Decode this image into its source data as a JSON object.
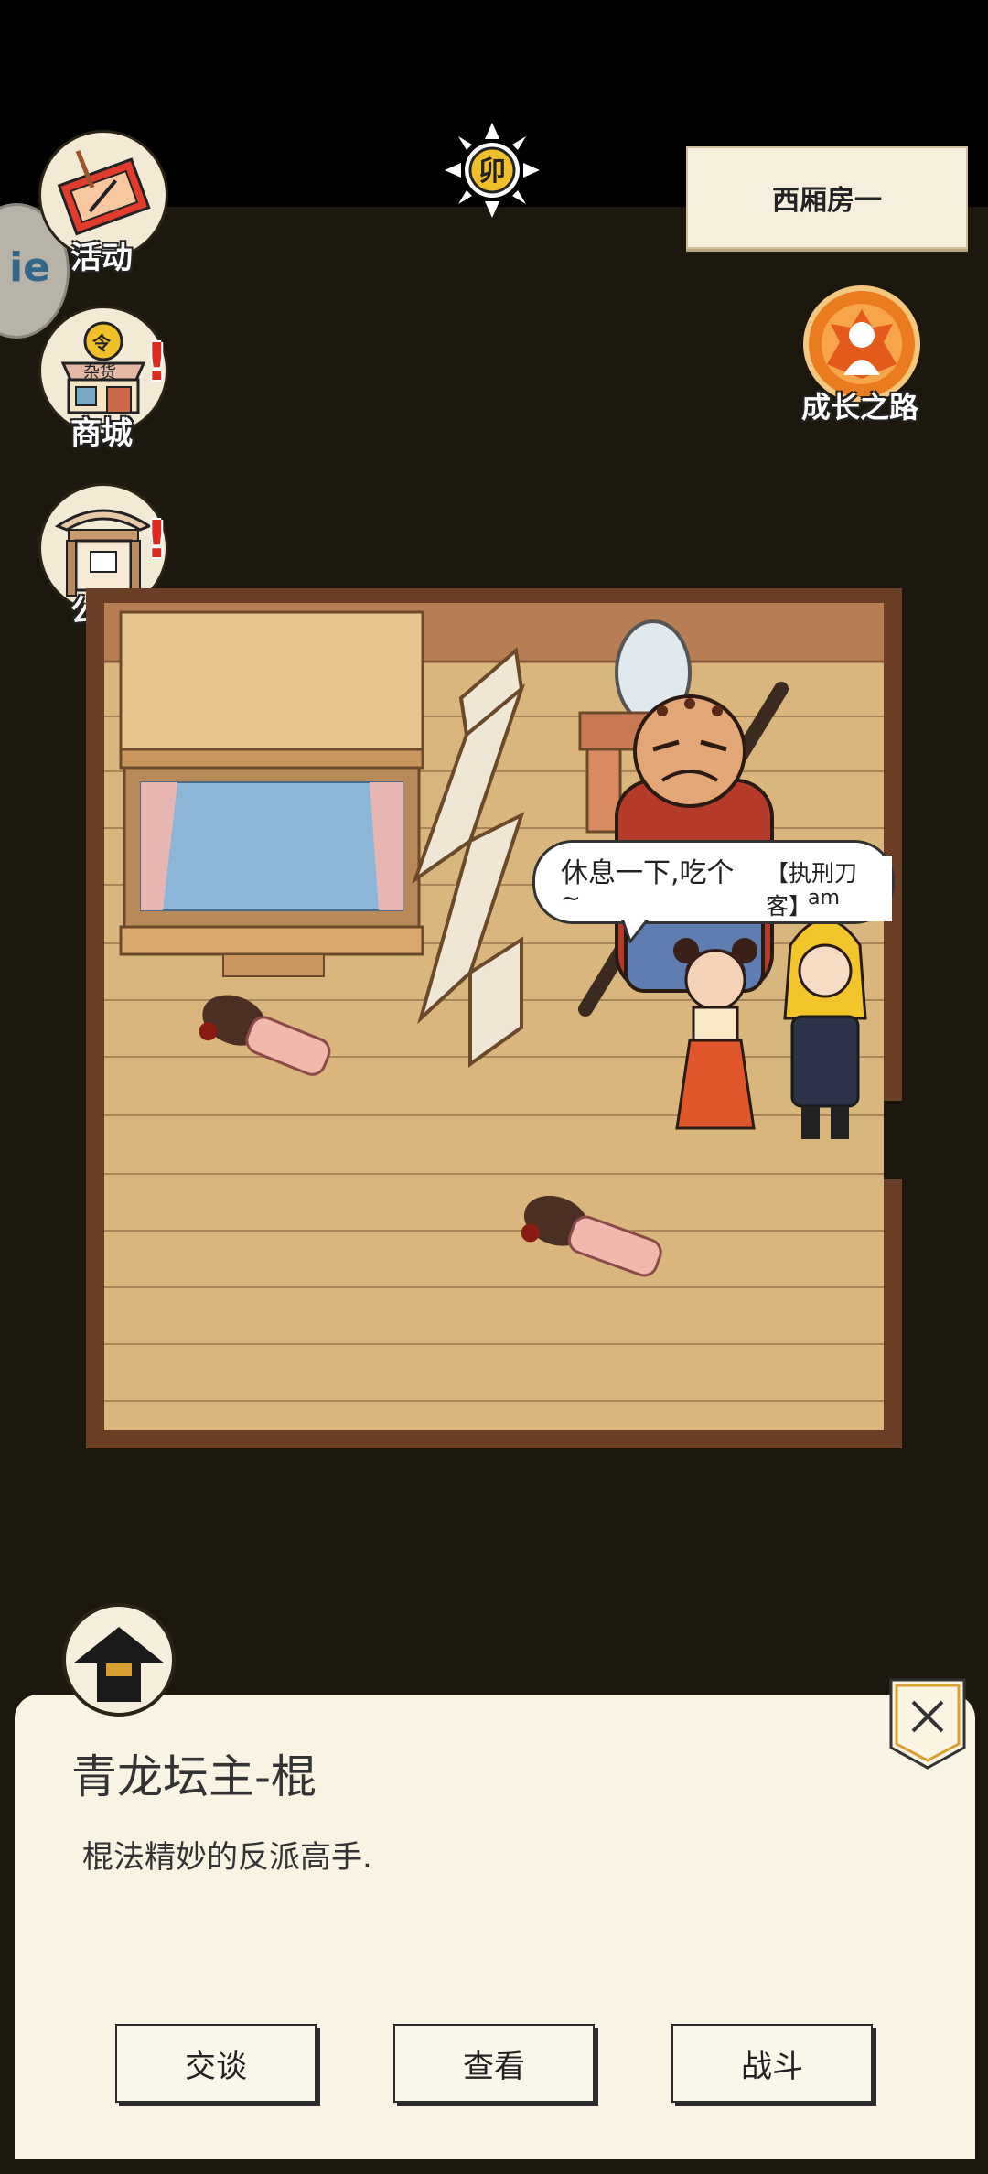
{
  "time": {
    "label": "卯"
  },
  "location": {
    "name": "西厢房一"
  },
  "side_tab": {
    "label": "ie"
  },
  "menu": {
    "activity": "活动",
    "shop": "商城",
    "notice": "公告",
    "shop_sign": "杂货",
    "shop_token": "令",
    "alert_mark": "!"
  },
  "growth": {
    "label": "成长之路"
  },
  "speech": {
    "line1": "休息一下,吃个",
    "npc_tag": "【执刑刀客】",
    "line2": "~",
    "line3": "am"
  },
  "npc": {
    "name": "青龙坛主-棍",
    "description": "棍法精妙的反派高手."
  },
  "actions": {
    "talk": "交谈",
    "view": "查看",
    "fight": "战斗"
  },
  "colors": {
    "background": "#1d180d",
    "panel": "#f9f3e4",
    "floor": "#d9b67d",
    "accent": "#ea7c1f",
    "alert": "#e02a1f"
  }
}
